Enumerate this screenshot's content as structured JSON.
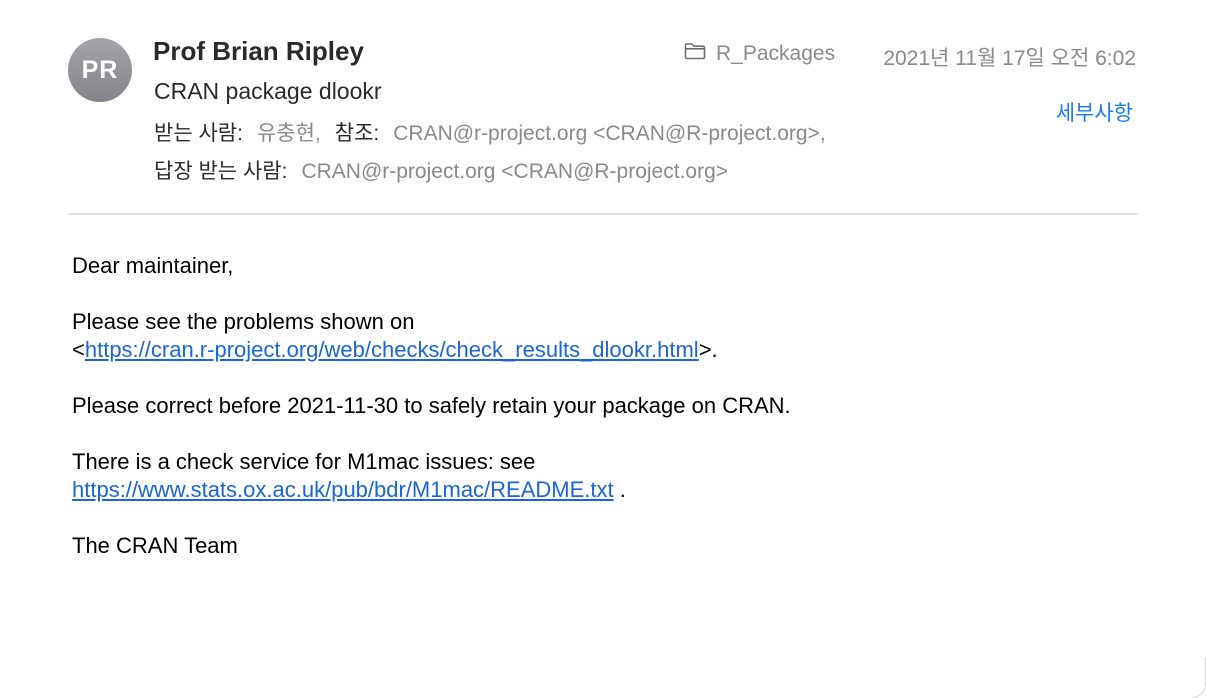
{
  "header": {
    "avatar_initials": "PR",
    "sender": "Prof Brian Ripley",
    "subject": "CRAN package dlookr",
    "to_label": "받는 사람:",
    "to_value": "유충현,",
    "cc_label": "참조:",
    "cc_value": "CRAN@r-project.org <CRAN@R-project.org>,",
    "reply_to_label": "답장 받는 사람:",
    "reply_to_value": "CRAN@r-project.org <CRAN@R-project.org>",
    "mailbox": "R_Packages",
    "mailbox_icon": "folder-icon",
    "date": "2021년 11월 17일 오전 6:02",
    "details_label": "세부사항"
  },
  "body": {
    "greeting": "Dear maintainer,",
    "p1_text": "Please see the problems shown on",
    "p1_link_open": "<",
    "p1_link": "https://cran.r-project.org/web/checks/check_results_dlookr.html",
    "p1_link_close": ">.",
    "p2_text": "Please correct before 2021-11-30 to safely retain your package on CRAN.",
    "p3_text": "There is a check service for M1mac issues: see",
    "p3_link": "https://www.stats.ox.ac.uk/pub/bdr/M1mac/README.txt",
    "p3_after": " .",
    "signoff": "The CRAN Team"
  },
  "colors": {
    "link": "#1a66d6",
    "details": "#1a7af0",
    "avatar": "#8e8e93",
    "muted_text": "#8a8a8e"
  }
}
